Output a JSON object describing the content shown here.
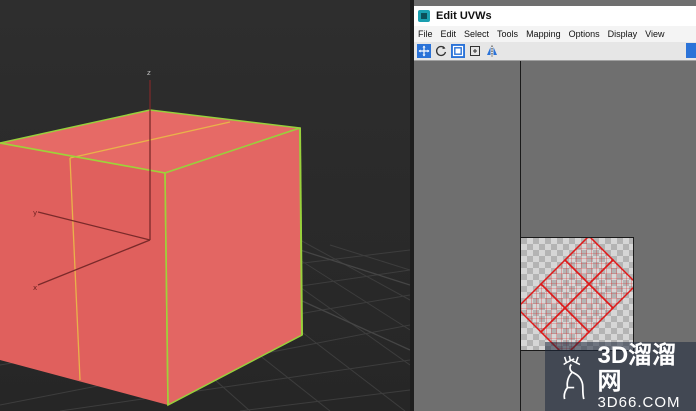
{
  "uvw_window": {
    "title": "Edit UVWs",
    "menu": [
      "File",
      "Edit",
      "Select",
      "Tools",
      "Mapping",
      "Options",
      "Display",
      "View"
    ],
    "toolbar": [
      {
        "name": "move-tool-icon",
        "active": true
      },
      {
        "name": "rotate-tool-icon",
        "active": false
      },
      {
        "name": "scale-tool-icon",
        "active": true
      },
      {
        "name": "freeform-tool-icon",
        "active": false
      },
      {
        "name": "mirror-tool-icon",
        "active": false
      }
    ]
  },
  "viewport": {
    "object": "cube",
    "object_color": "#e8625f",
    "edge_color": "#9fd23a",
    "axis_labels": {
      "z": "z",
      "x": "x",
      "y": "y"
    }
  },
  "watermark": {
    "main": "3D溜溜网",
    "sub": "3D66.COM"
  },
  "colors": {
    "uv_shell_edges": "#e01818",
    "selection_blue": "#2b73d8"
  }
}
